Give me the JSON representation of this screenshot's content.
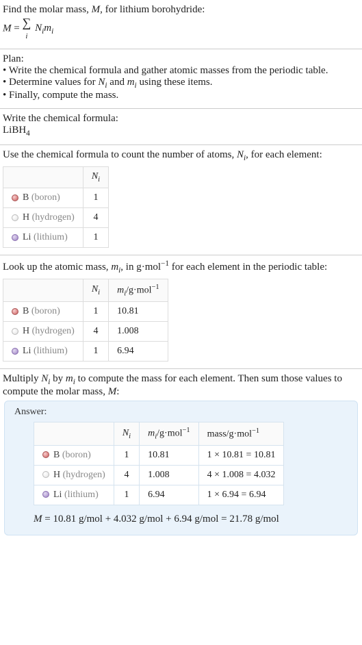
{
  "intro": {
    "line1_a": "Find the molar mass, ",
    "line1_b": ", for lithium borohydride:",
    "M": "M",
    "eq_lhs": "M",
    "eq_eq": " = ",
    "sum": "∑",
    "sum_sub": "i",
    "Ni": "N",
    "Ni_sub": "i",
    "mi": "m",
    "mi_sub": "i"
  },
  "plan": {
    "title": "Plan:",
    "b1": "• Write the chemical formula and gather atomic masses from the periodic table.",
    "b2_a": "• Determine values for ",
    "b2_b": " and ",
    "b2_c": " using these items.",
    "b3": "• Finally, compute the mass."
  },
  "formula_section": {
    "title": "Write the chemical formula:",
    "f_a": "LiBH",
    "f_sub": "4"
  },
  "count_section": {
    "text_a": "Use the chemical formula to count the number of atoms, ",
    "text_b": ", for each element:",
    "hdr_N": "N",
    "hdr_N_sub": "i"
  },
  "elements": [
    {
      "dotClass": "boron",
      "sym": "B",
      "name": "(boron)",
      "N": "1",
      "m": "10.81",
      "mass": "1 × 10.81 = 10.81"
    },
    {
      "dotClass": "hydrogen",
      "sym": "H",
      "name": "(hydrogen)",
      "N": "4",
      "m": "1.008",
      "mass": "4 × 1.008 = 4.032"
    },
    {
      "dotClass": "lithium",
      "sym": "Li",
      "name": "(lithium)",
      "N": "1",
      "m": "6.94",
      "mass": "1 × 6.94 = 6.94"
    }
  ],
  "mass_section": {
    "text_a": "Look up the atomic mass, ",
    "text_b": ", in g·mol",
    "text_exp": "−1",
    "text_c": " for each element in the periodic table:",
    "hdr_m": "m",
    "hdr_m_sub": "i",
    "hdr_unit_a": "/g·mol",
    "hdr_unit_exp": "−1"
  },
  "multiply_section": {
    "text_a": "Multiply ",
    "text_b": " by ",
    "text_c": " to compute the mass for each element. Then sum those values to compute the molar mass, ",
    "text_d": ":"
  },
  "answer": {
    "label": "Answer:",
    "hdr_mass_a": "mass/g·mol",
    "hdr_mass_exp": "−1",
    "final_a": "M",
    "final_b": " = 10.81 g/mol + 4.032 g/mol + 6.94 g/mol = 21.78 g/mol"
  }
}
